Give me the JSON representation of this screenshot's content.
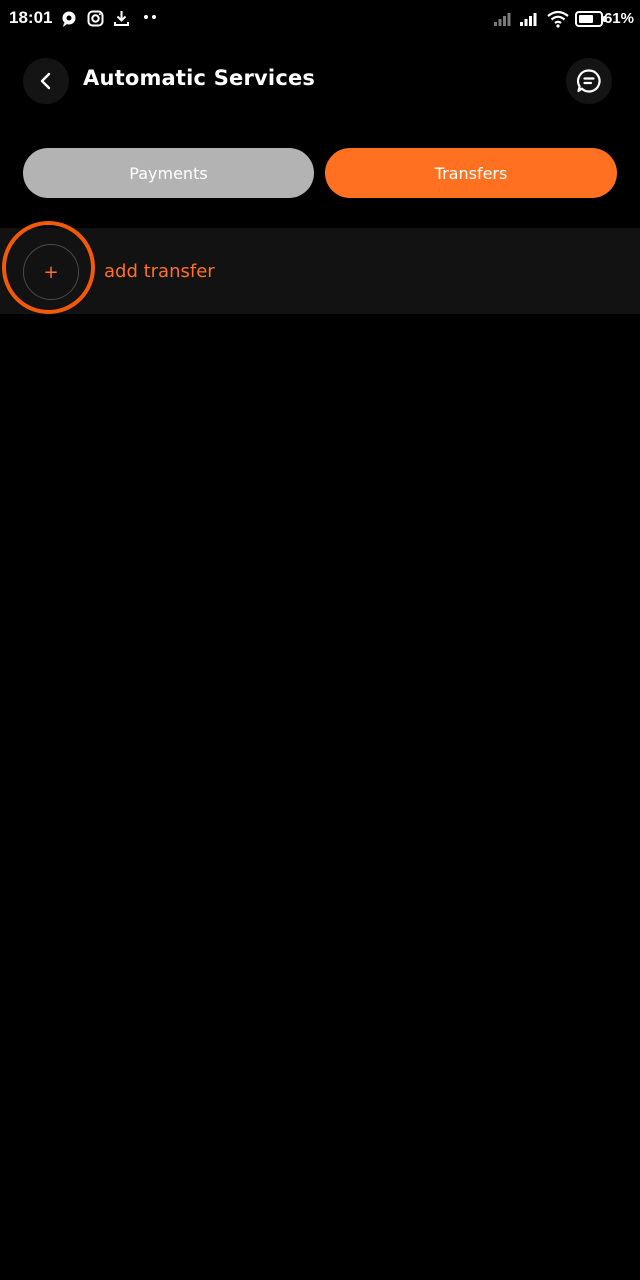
{
  "status_bar": {
    "time": "18:01",
    "battery": "61%"
  },
  "header": {
    "title": "Automatic Services",
    "back_icon": "chevron-left-icon",
    "chat_icon": "chat-bubble-icon"
  },
  "tabs": [
    {
      "label": "Payments",
      "active": false
    },
    {
      "label": "Transfers",
      "active": true
    }
  ],
  "add_transfer": {
    "icon": "+",
    "label": "add transfer"
  },
  "colors": {
    "accent": "#ff7120",
    "highlight_ring": "#f25a0a",
    "inactive_tab": "#b3b3b3",
    "background": "#000000",
    "row_background": "#121212"
  }
}
